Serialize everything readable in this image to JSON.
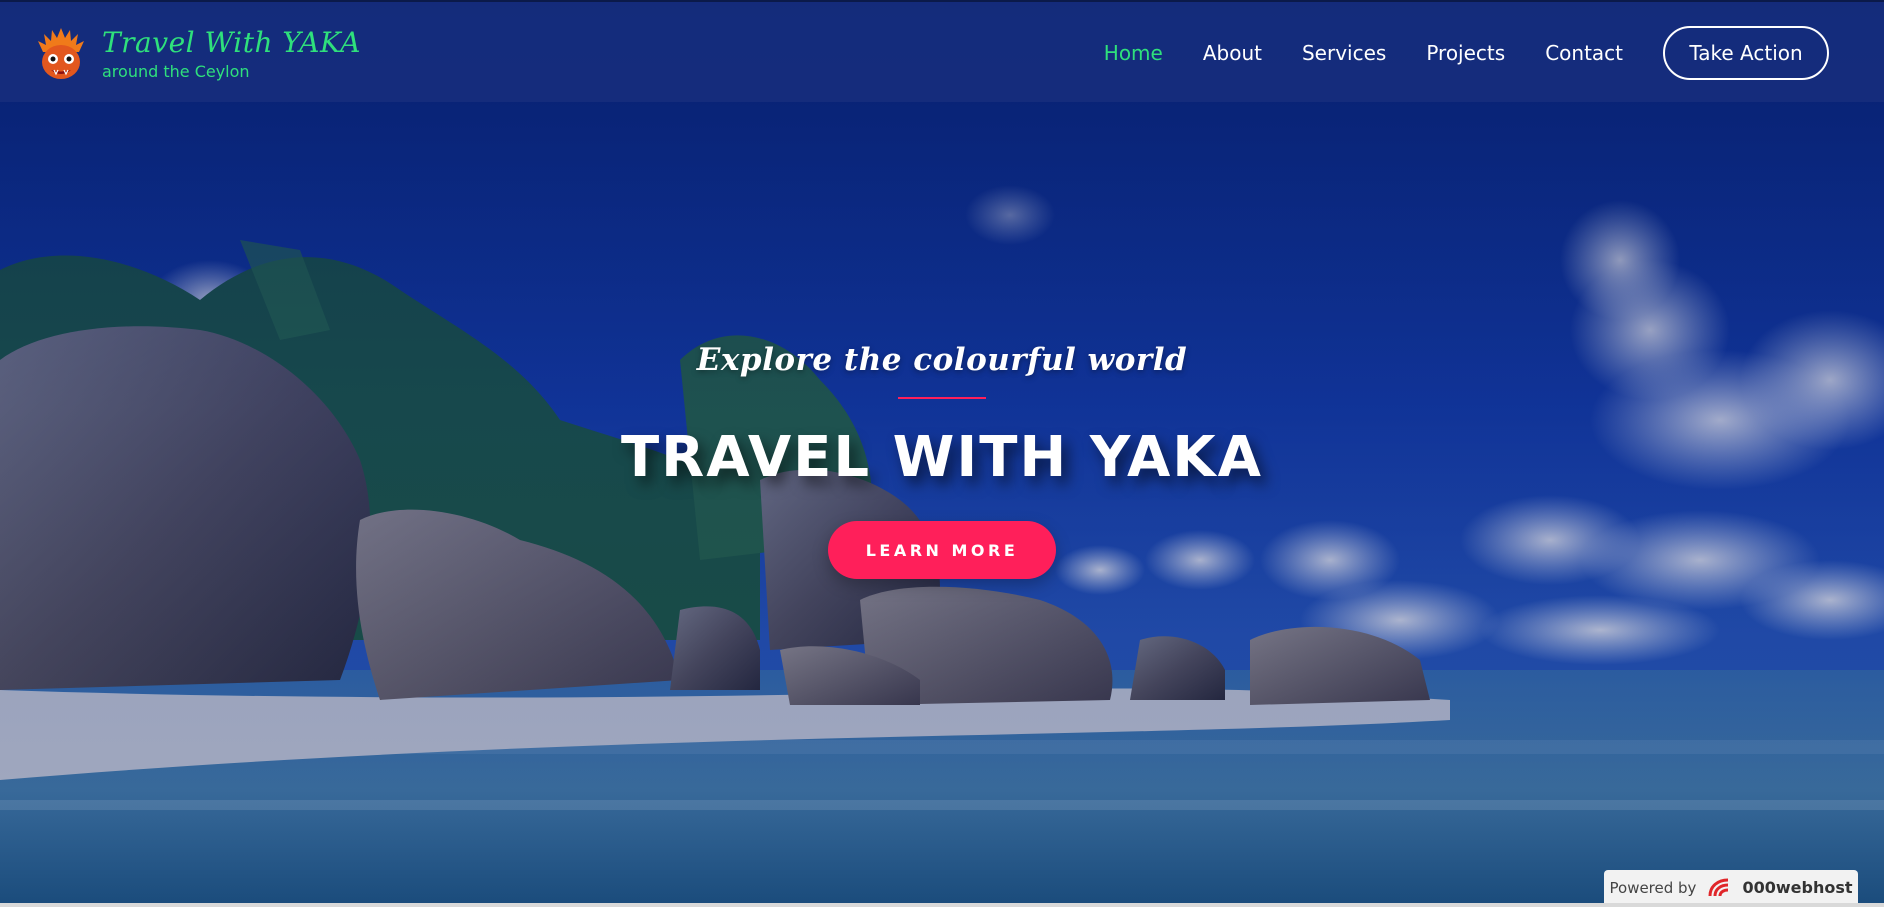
{
  "brand": {
    "title": "Travel With YAKA",
    "subtitle": "around the Ceylon",
    "logo_icon": "yaka-mask-icon"
  },
  "nav": {
    "items": [
      {
        "label": "Home",
        "active": true
      },
      {
        "label": "About",
        "active": false
      },
      {
        "label": "Services",
        "active": false
      },
      {
        "label": "Projects",
        "active": false
      },
      {
        "label": "Contact",
        "active": false
      }
    ],
    "cta_label": "Take Action"
  },
  "hero": {
    "tagline": "Explore the colourful world",
    "headline": "TRAVEL WITH YAKA",
    "button_label": "LEARN MORE",
    "background": "tropical-beach-with-granite-boulders"
  },
  "footer_badge": {
    "prefix": "Powered by",
    "host": "000webhost",
    "icon": "000webhost-logo-icon"
  },
  "colors": {
    "accent_green": "#2fe07c",
    "accent_pink": "#ff1f5a",
    "nav_bg": "#172d7d",
    "sky_blue": "#0a2a8a"
  }
}
